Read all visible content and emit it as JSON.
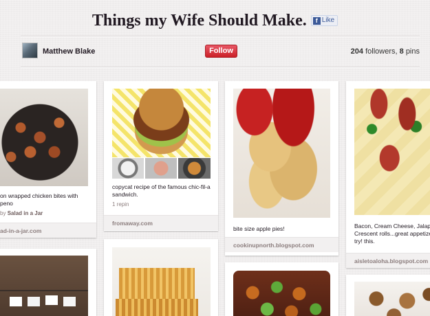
{
  "board": {
    "title": "Things my Wife Should Make.",
    "like_label": "Like"
  },
  "owner": {
    "name": "Matthew Blake",
    "follow_label": "Follow",
    "followers_count": "204",
    "followers_label": "followers,",
    "pins_count": "8",
    "pins_label": "pins"
  },
  "pins": [
    {
      "description_line1": "on wrapped chicken bites with",
      "description_line2": "peno",
      "meta_prefix": "by",
      "meta_user": "Salad in a Jar",
      "source": "ad-in-a-jar.com"
    },
    {
      "description_line1": "copycat recipe of the famous chic-fil-a",
      "description_line2": "sandwich.",
      "repins": "1 repin",
      "source": "fromaway.com"
    },
    {
      "description": "bite size apple pies!",
      "source": "cookinupnorth.blogspot.com"
    },
    {
      "description_line1": "Bacon, Cream Cheese, Jalape",
      "description_line2": "Crescent rolls...great appetizer",
      "description_line3": "try! this.",
      "source": "aisletoaloha.blogspot.com"
    }
  ]
}
